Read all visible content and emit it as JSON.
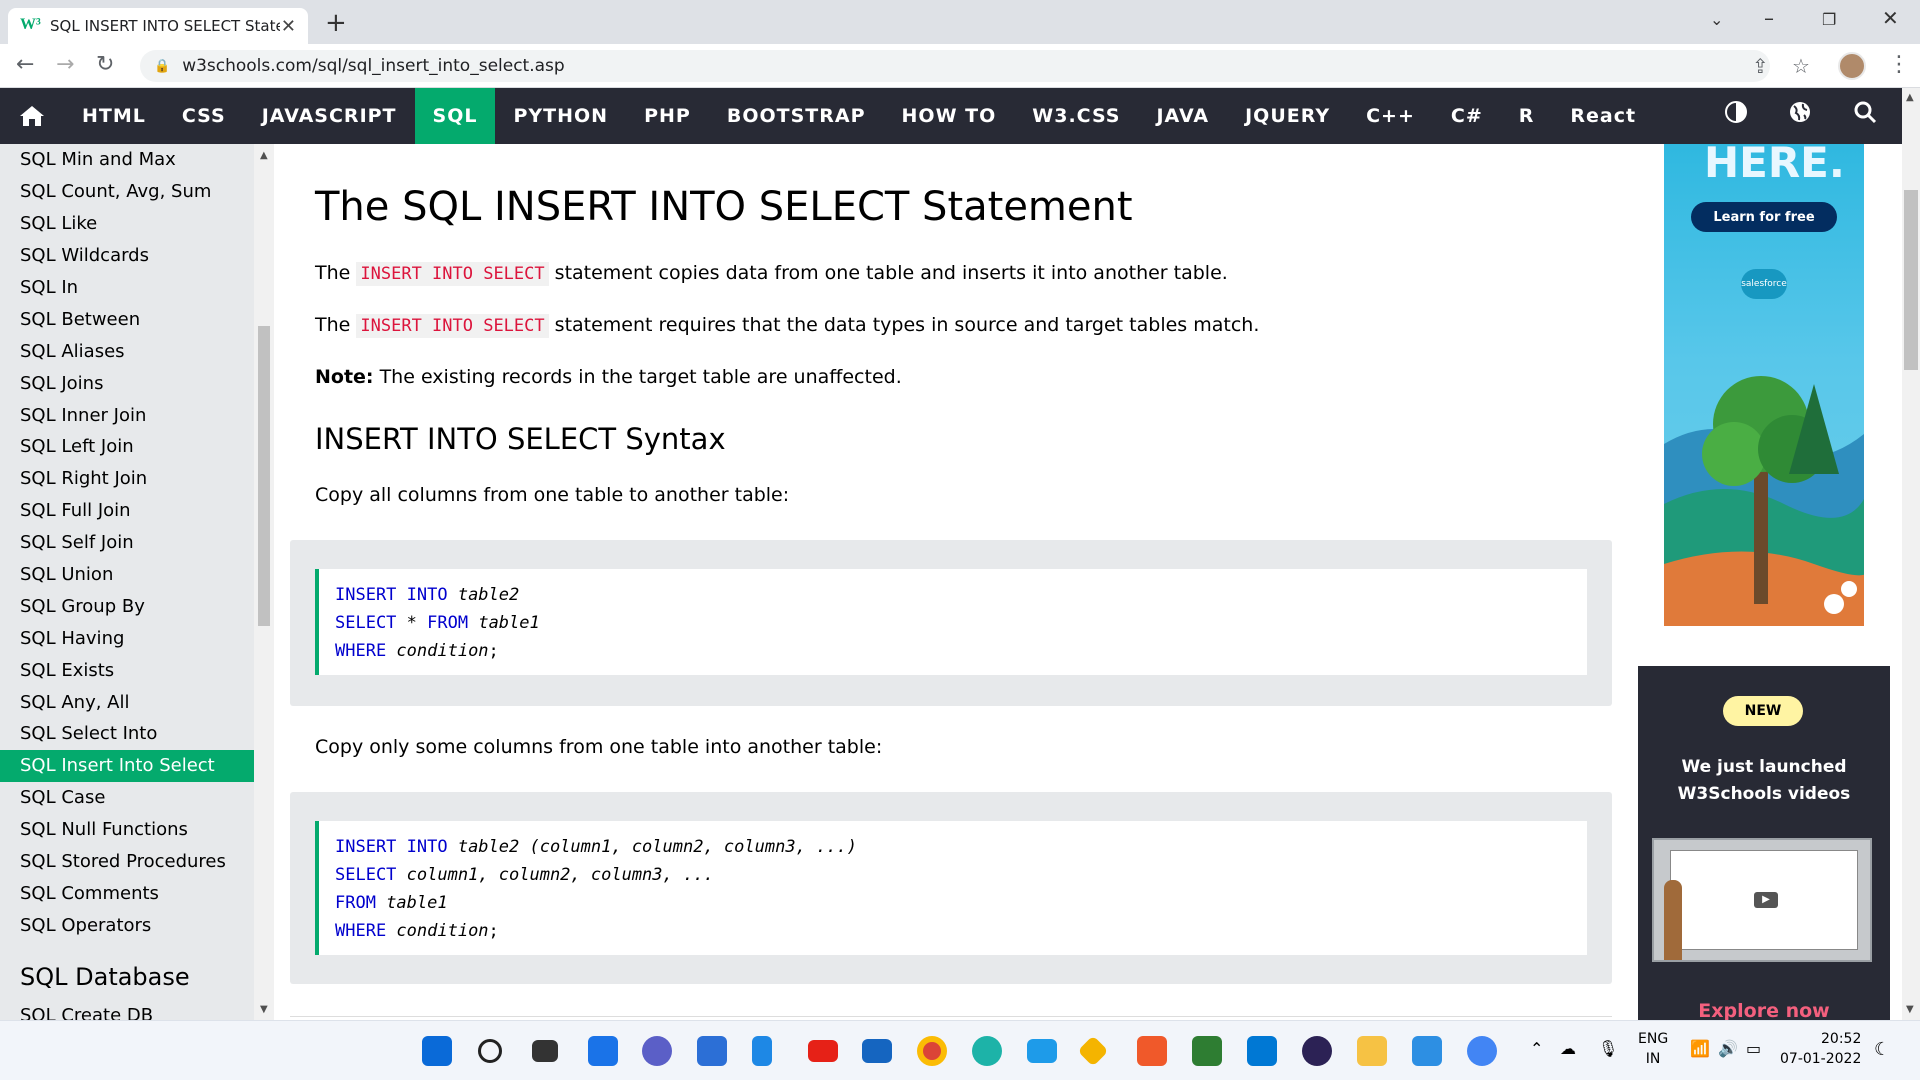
{
  "browser": {
    "tab_title": "SQL INSERT INTO SELECT Statem",
    "url": "w3schools.com/sql/sql_insert_into_select.asp"
  },
  "topnav": {
    "items": [
      "HTML",
      "CSS",
      "JAVASCRIPT",
      "SQL",
      "PYTHON",
      "PHP",
      "BOOTSTRAP",
      "HOW TO",
      "W3.CSS",
      "JAVA",
      "JQUERY",
      "C++",
      "C#",
      "R",
      "React"
    ],
    "active": "SQL"
  },
  "sidebar": {
    "links": [
      "SQL Min and Max",
      "SQL Count, Avg, Sum",
      "SQL Like",
      "SQL Wildcards",
      "SQL In",
      "SQL Between",
      "SQL Aliases",
      "SQL Joins",
      "SQL Inner Join",
      "SQL Left Join",
      "SQL Right Join",
      "SQL Full Join",
      "SQL Self Join",
      "SQL Union",
      "SQL Group By",
      "SQL Having",
      "SQL Exists",
      "SQL Any, All",
      "SQL Select Into",
      "SQL Insert Into Select",
      "SQL Case",
      "SQL Null Functions",
      "SQL Stored Procedures",
      "SQL Comments",
      "SQL Operators"
    ],
    "active": "SQL Insert Into Select",
    "section_heading": "SQL Database",
    "cut_link": "SQL Create DB"
  },
  "main": {
    "title": "The SQL INSERT INTO SELECT Statement",
    "p1_before": "The ",
    "p1_code": "INSERT INTO SELECT",
    "p1_after": " statement copies data from one table and inserts it into another table.",
    "p2_before": "The ",
    "p2_code": "INSERT INTO SELECT",
    "p2_after": " statement requires that the data types in source and target tables match.",
    "note_label": "Note:",
    "note_text": " The existing records in the target table are unaffected.",
    "syntax_heading": "INSERT INTO SELECT Syntax",
    "copy_all": "Copy all columns from one table to another table:",
    "copy_some": "Copy only some columns from one table into another table:",
    "code1": [
      [
        {
          "k": "INSERT INTO "
        },
        {
          "i": "table2"
        }
      ],
      [
        {
          "k": "SELECT"
        },
        {
          "t": " * "
        },
        {
          "k": "FROM "
        },
        {
          "i": "table1"
        }
      ],
      [
        {
          "k": "WHERE "
        },
        {
          "i": "condition"
        },
        {
          "t": ";"
        }
      ]
    ],
    "code2": [
      [
        {
          "k": "INSERT INTO "
        },
        {
          "i": "table2 (column1, column2, column3, ...)"
        }
      ],
      [
        {
          "k": "SELECT "
        },
        {
          "i": "column1, column2, column3, ..."
        }
      ],
      [
        {
          "k": "FROM "
        },
        {
          "i": "table1"
        }
      ],
      [
        {
          "k": "WHERE "
        },
        {
          "i": "condition"
        },
        {
          "t": ";"
        }
      ]
    ]
  },
  "ads": {
    "top_heading": "HERE.",
    "learn_button": "Learn for free",
    "brand": "salesforce",
    "badge": "NEW",
    "promo_line1": "We just launched",
    "promo_line2": "W3Schools videos",
    "explore": "Explore now"
  },
  "taskbar": {
    "lang_line1": "ENG",
    "lang_line2": "IN",
    "time": "20:52",
    "date": "07-01-2022"
  },
  "colors": {
    "accent": "#04aa6d",
    "nav_bg": "#282a35",
    "code_red": "#dc143c",
    "code_blue": "#0000cd"
  }
}
